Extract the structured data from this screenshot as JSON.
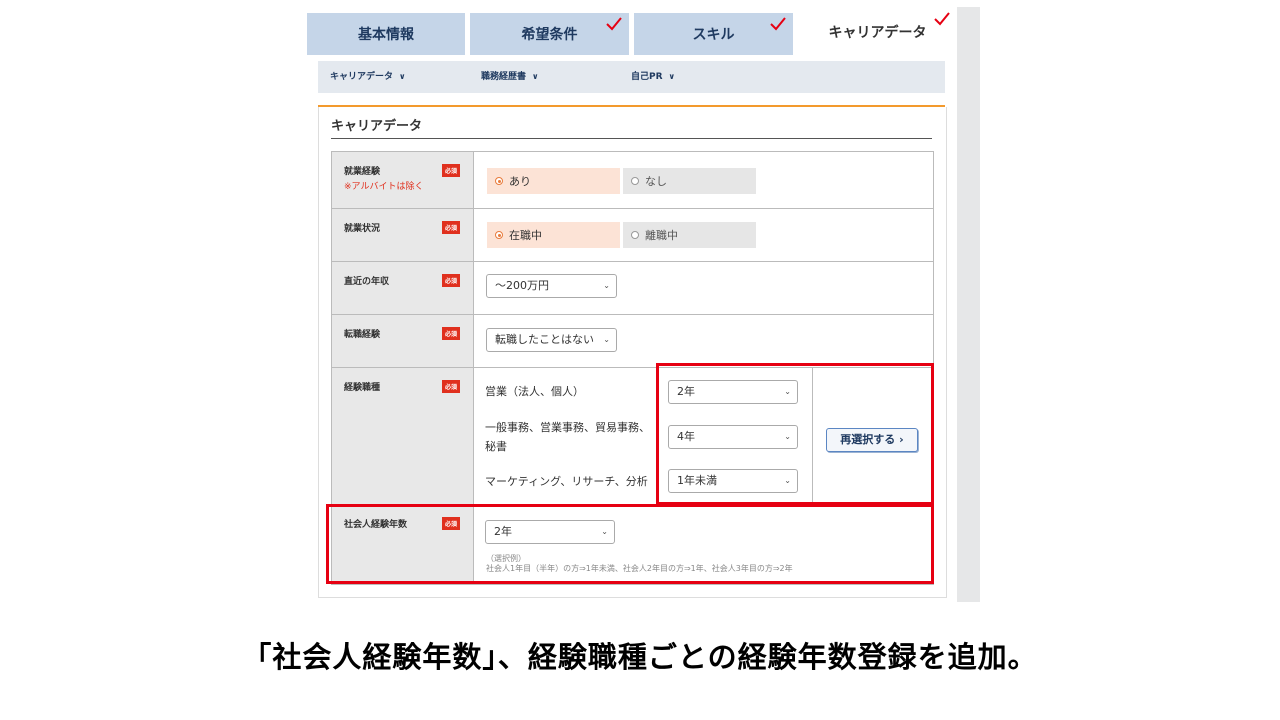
{
  "tabs": [
    {
      "label": "基本情報",
      "checked": false
    },
    {
      "label": "希望条件",
      "checked": true
    },
    {
      "label": "スキル",
      "checked": true
    },
    {
      "label": "キャリアデータ",
      "checked": true,
      "active": true
    }
  ],
  "subnav": [
    "キャリアデータ",
    "職務経歴書",
    "自己PR"
  ],
  "section_title": "キャリアデータ",
  "required_badge": "必須",
  "rows": {
    "work_exp": {
      "label": "就業経験",
      "sub": "※アルバイトは除く",
      "options": [
        "あり",
        "なし"
      ],
      "selected": "あり"
    },
    "work_status": {
      "label": "就業状況",
      "options": [
        "在職中",
        "離職中"
      ],
      "selected": "在職中"
    },
    "income": {
      "label": "直近の年収",
      "value": "〜200万円"
    },
    "job_change": {
      "label": "転職経験",
      "value": "転職したことはない"
    },
    "job_types": {
      "label": "経験職種",
      "items": [
        {
          "name": "営業（法人、個人）",
          "years": "2年"
        },
        {
          "name": "一般事務、営業事務、貿易事務、秘書",
          "years": "4年"
        },
        {
          "name": "マーケティング、リサーチ、分析",
          "years": "1年未満"
        }
      ],
      "reselect": "再選択する"
    },
    "social_years": {
      "label": "社会人経験年数",
      "value": "2年",
      "hint_title": "（選択例）",
      "hint_text": "社会人1年目（半年）の方⇒1年未満、社会人2年目の方⇒1年、社会人3年目の方⇒2年"
    }
  },
  "caption": "「社会人経験年数」、経験職種ごとの経験年数登録を追加。",
  "colors": {
    "accent_red": "#e60012",
    "tab_blue": "#c5d5e8",
    "section_orange": "#f39a2d",
    "radio_selected": "#fce3d6"
  }
}
